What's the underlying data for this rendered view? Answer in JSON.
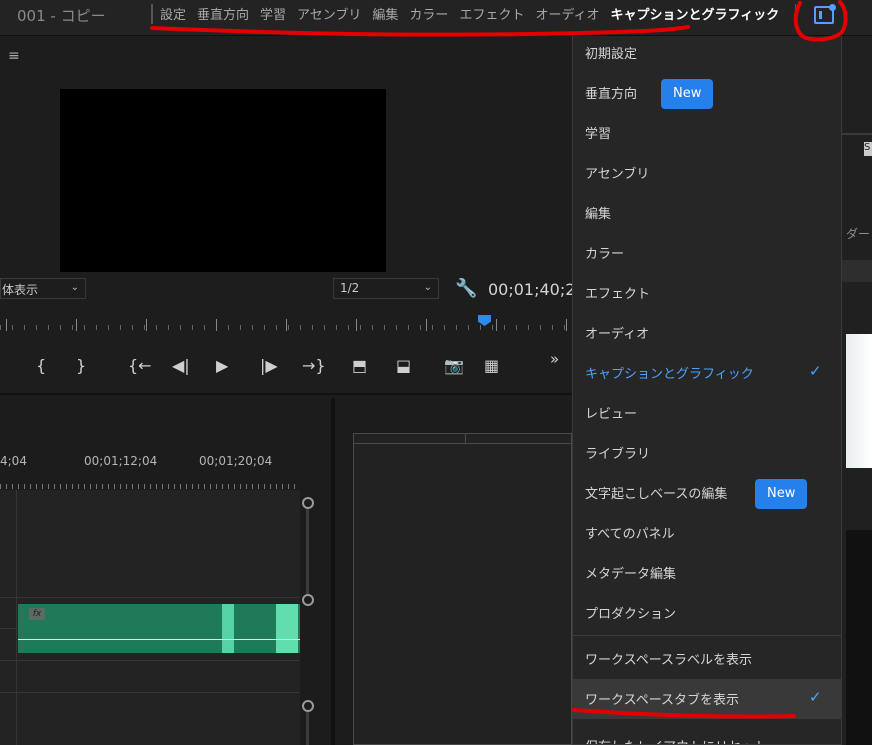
{
  "header": {
    "sequence_title": "001 - コピー",
    "workspace_tabs": [
      {
        "label": "設定",
        "active": false
      },
      {
        "label": "垂直方向",
        "active": false
      },
      {
        "label": "学習",
        "active": false
      },
      {
        "label": "アセンブリ",
        "active": false
      },
      {
        "label": "編集",
        "active": false
      },
      {
        "label": "カラー",
        "active": false
      },
      {
        "label": "エフェクト",
        "active": false
      },
      {
        "label": "オーディオ",
        "active": false
      },
      {
        "label": "キャプションとグラフィック",
        "active": true
      }
    ],
    "workspace_button_icon": "workspaces-icon"
  },
  "program_monitor": {
    "menu_icon": "≡",
    "fit_select_value": "体表示",
    "resolution_value": "1/2",
    "timecode": "00;01;40;2",
    "overflow_icon": "»"
  },
  "transport": {
    "buttons": [
      {
        "name": "mark-in-icon",
        "glyph": "{"
      },
      {
        "name": "mark-out-icon",
        "glyph": "}"
      },
      {
        "name": "go-to-in-icon",
        "glyph": "{←"
      },
      {
        "name": "step-back-icon",
        "glyph": "◀|"
      },
      {
        "name": "play-icon",
        "glyph": "▶"
      },
      {
        "name": "step-forward-icon",
        "glyph": "|▶"
      },
      {
        "name": "go-to-out-icon",
        "glyph": "→}"
      },
      {
        "name": "lift-icon",
        "glyph": "⬒"
      },
      {
        "name": "extract-icon",
        "glyph": "⬓"
      },
      {
        "name": "export-frame-icon",
        "glyph": "📷"
      },
      {
        "name": "comparison-view-icon",
        "glyph": "▦"
      }
    ]
  },
  "timeline": {
    "times": [
      "4;04",
      "00;01;12;04",
      "00;01;20;04"
    ],
    "clip_fx": "fx"
  },
  "right_strip": {
    "partial_text": "ダー",
    "badge": "S"
  },
  "workspace_menu": {
    "items": [
      {
        "label": "初期設定",
        "new": false,
        "checked": false
      },
      {
        "label": "垂直方向",
        "new": true,
        "checked": false
      },
      {
        "label": "学習",
        "new": false,
        "checked": false
      },
      {
        "label": "アセンブリ",
        "new": false,
        "checked": false
      },
      {
        "label": "編集",
        "new": false,
        "checked": false
      },
      {
        "label": "カラー",
        "new": false,
        "checked": false
      },
      {
        "label": "エフェクト",
        "new": false,
        "checked": false
      },
      {
        "label": "オーディオ",
        "new": false,
        "checked": false
      },
      {
        "label": "キャプションとグラフィック",
        "new": false,
        "checked": true
      },
      {
        "label": "レビュー",
        "new": false,
        "checked": false
      },
      {
        "label": "ライブラリ",
        "new": false,
        "checked": false
      },
      {
        "label": "文字起こしベースの編集",
        "new": true,
        "checked": false
      },
      {
        "label": "すべてのパネル",
        "new": false,
        "checked": false
      },
      {
        "label": "メタデータ編集",
        "new": false,
        "checked": false
      },
      {
        "label": "プロダクション",
        "new": false,
        "checked": false
      }
    ],
    "new_badge_label": "New",
    "show_labels": "ワークスペースラベルを表示",
    "show_tabs": "ワークスペースタブを表示",
    "show_tabs_checked": true,
    "reset_partial": "保存したレイアウトにリセット",
    "check_glyph": "✓"
  },
  "colors": {
    "accent": "#2680eb",
    "annotation": "#e50000",
    "clip": "#1f7a5a"
  }
}
